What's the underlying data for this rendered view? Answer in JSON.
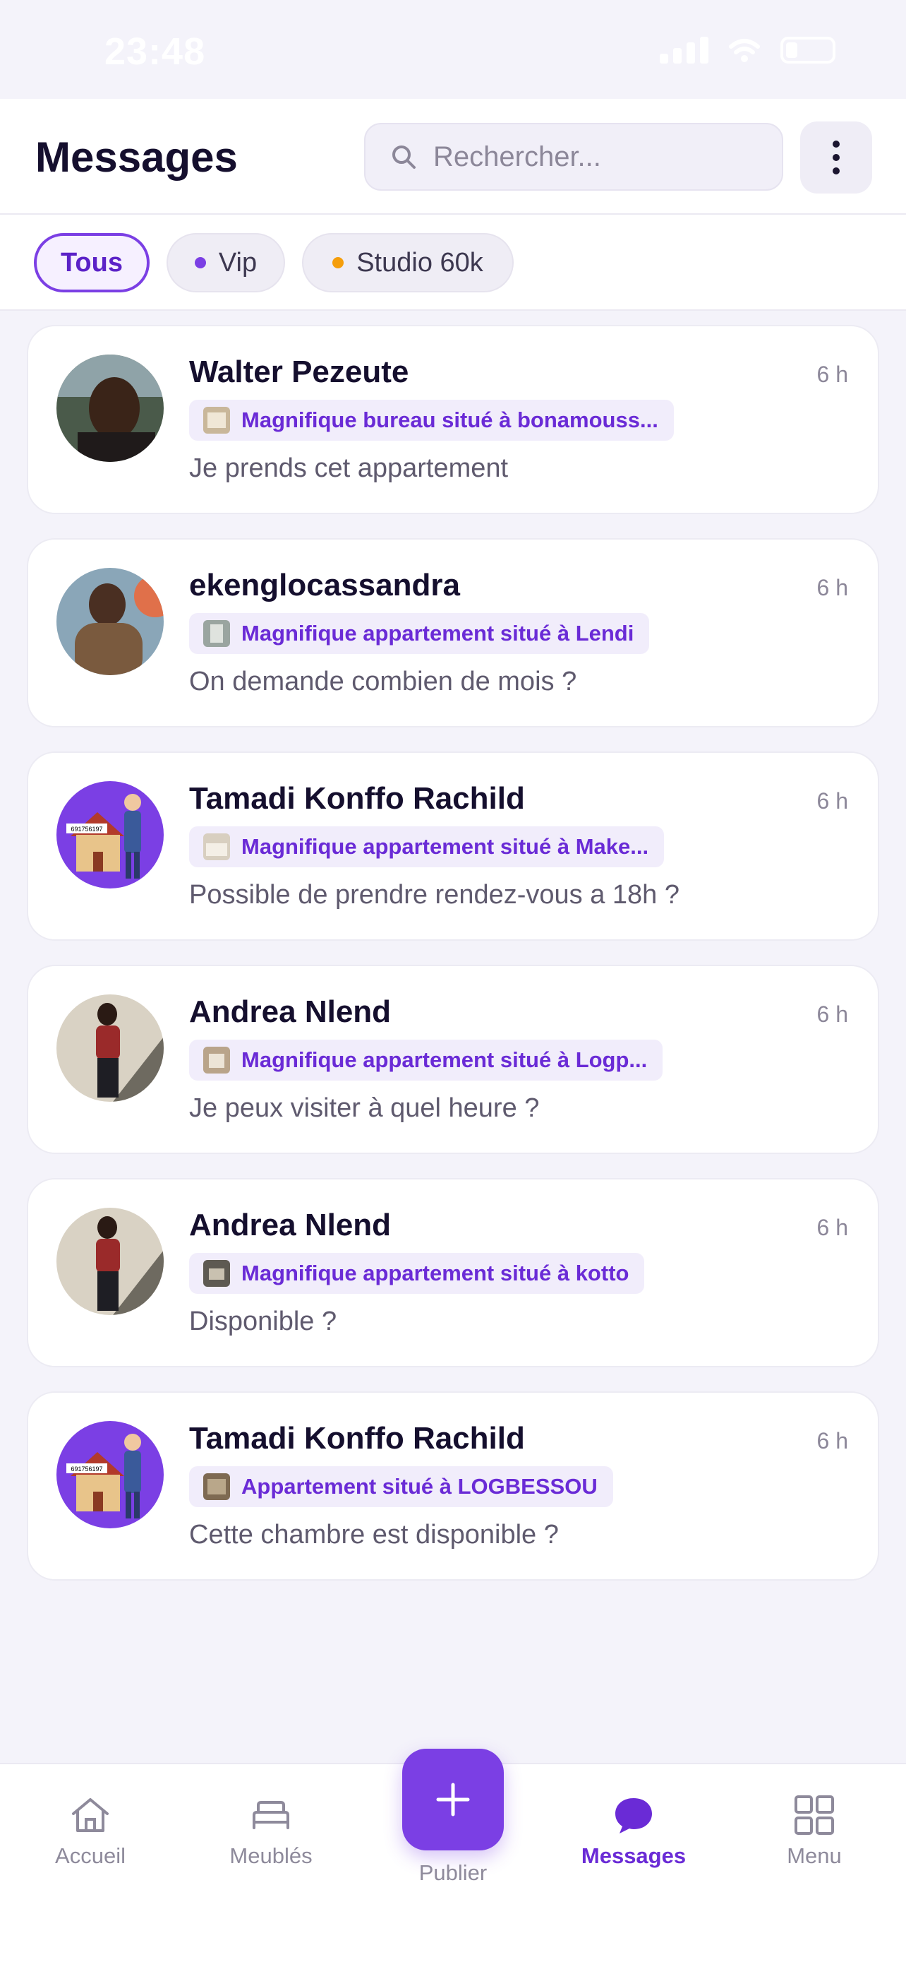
{
  "status_bar": {
    "time": "23:48"
  },
  "header": {
    "title": "Messages",
    "search_placeholder": "Rechercher...",
    "more_icon": "more-vertical-icon"
  },
  "filters": [
    {
      "label": "Tous",
      "active": true,
      "dot_color": null
    },
    {
      "label": "Vip",
      "active": false,
      "dot_color": "#7b3fe4"
    },
    {
      "label": "Studio 60k",
      "active": false,
      "dot_color": "#f59e0b"
    }
  ],
  "conversations": [
    {
      "name": "Walter Pezeute",
      "time": "6 h",
      "listing": "Magnifique bureau situé à bonamouss...",
      "preview": "Je prends cet appartement",
      "avatar": "photo-man"
    },
    {
      "name": "ekenglocassandra",
      "time": "6 h",
      "listing": "Magnifique appartement situé à Lendi",
      "preview": "On demande combien de mois ?",
      "avatar": "photo-woman"
    },
    {
      "name": "Tamadi Konffo Rachild",
      "time": "6 h",
      "listing": "Magnifique appartement situé à Make...",
      "preview": "Possible de prendre rendez-vous a 18h ?",
      "avatar": "illustration-house",
      "avatar_text": "691756197"
    },
    {
      "name": "Andrea Nlend",
      "time": "6 h",
      "listing": "Magnifique appartement situé à Logp...",
      "preview": "Je peux visiter à quel heure ?",
      "avatar": "photo-woman-stairs"
    },
    {
      "name": "Andrea Nlend",
      "time": "6 h",
      "listing": "Magnifique appartement situé à kotto",
      "preview": "Disponible ?",
      "avatar": "photo-woman-stairs"
    },
    {
      "name": "Tamadi Konffo Rachild",
      "time": "6 h",
      "listing": "Appartement situé à LOGBESSOU",
      "preview": "Cette chambre est disponible ?",
      "avatar": "illustration-house",
      "avatar_text": "691756197"
    }
  ],
  "bottom_nav": {
    "items": [
      {
        "label": "Accueil",
        "icon": "home-icon",
        "active": false
      },
      {
        "label": "Meublés",
        "icon": "bed-icon",
        "active": false
      },
      {
        "label": "Publier",
        "icon": "plus-icon",
        "active": false
      },
      {
        "label": "Messages",
        "icon": "chat-bubble-icon",
        "active": true
      },
      {
        "label": "Menu",
        "icon": "grid-icon",
        "active": false
      }
    ]
  },
  "colors": {
    "accent": "#7b3fe4",
    "accent_text": "#6a2bd6",
    "background": "#f4f3fa"
  }
}
